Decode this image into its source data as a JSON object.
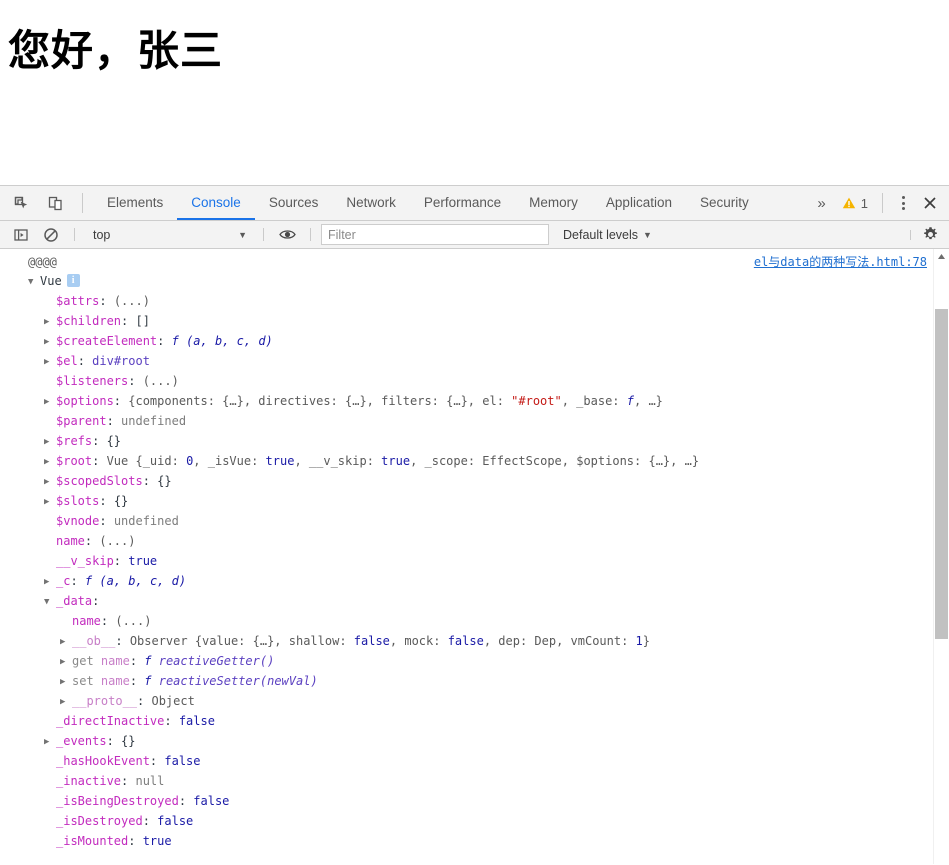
{
  "page": {
    "heading": "您好，张三"
  },
  "devtools": {
    "toolbar": {
      "inspect_icon": "inspect-element-icon",
      "device_icon": "device-toolbar-icon",
      "overflow_label": "»",
      "warning_count": "1",
      "warning_icon": "warning-triangle-icon",
      "kebab_label": "more-tools",
      "close_label": "close-devtools"
    },
    "tabs": [
      {
        "label": "Elements",
        "active": false
      },
      {
        "label": "Console",
        "active": true
      },
      {
        "label": "Sources",
        "active": false
      },
      {
        "label": "Network",
        "active": false
      },
      {
        "label": "Performance",
        "active": false
      },
      {
        "label": "Memory",
        "active": false
      },
      {
        "label": "Application",
        "active": false
      },
      {
        "label": "Security",
        "active": false
      }
    ],
    "filterbar": {
      "sidebar_icon": "console-sidebar-toggle-icon",
      "clear_icon": "clear-console-icon",
      "context_value": "top",
      "context_caret": "▼",
      "eye_icon": "live-expression-eye-icon",
      "filter_placeholder": "Filter",
      "filter_value": "",
      "levels_label": "Default levels",
      "levels_caret": "▼",
      "settings_icon": "settings-gear-icon"
    },
    "console": {
      "source_link": "el与data的两种写法.html:78",
      "at_line": "@@@@",
      "object_label": "Vue",
      "info_badge": "i",
      "lines": [
        {
          "indent": 1,
          "tri": "none",
          "key": "$attrs",
          "keycls": "prop",
          "sep": ": ",
          "value": "(...)",
          "valcls": "val-obj"
        },
        {
          "indent": 1,
          "tri": "closed",
          "key": "$children",
          "keycls": "prop",
          "sep": ": ",
          "value": "[]",
          "valcls": "punct"
        },
        {
          "indent": 1,
          "tri": "closed",
          "key": "$createElement",
          "keycls": "prop",
          "sep": ": ",
          "value": "f (a, b, c, d)",
          "valcls": "fn"
        },
        {
          "indent": 1,
          "tri": "closed",
          "key": "$el",
          "keycls": "prop",
          "sep": ": ",
          "value": "div#root",
          "valcls": "val-node"
        },
        {
          "indent": 1,
          "tri": "none",
          "key": "$listeners",
          "keycls": "prop",
          "sep": ": ",
          "value": "(...)",
          "valcls": "val-obj"
        },
        {
          "indent": 1,
          "tri": "closed",
          "key": "$options",
          "keycls": "prop",
          "sep": ": ",
          "value": "{components: {…}, directives: {…}, filters: {…}, el: \"#root\", _base: f, …}",
          "valcls": "val-obj",
          "html": "options"
        },
        {
          "indent": 1,
          "tri": "none",
          "key": "$parent",
          "keycls": "prop",
          "sep": ": ",
          "value": "undefined",
          "valcls": "val-null"
        },
        {
          "indent": 1,
          "tri": "closed",
          "key": "$refs",
          "keycls": "prop",
          "sep": ": ",
          "value": "{}",
          "valcls": "punct"
        },
        {
          "indent": 1,
          "tri": "closed",
          "key": "$root",
          "keycls": "prop",
          "sep": ": ",
          "value": "Vue {_uid: 0, _isVue: true, __v_skip: true, _scope: EffectScope, $options: {…}, …}",
          "valcls": "val-obj",
          "html": "root"
        },
        {
          "indent": 1,
          "tri": "closed",
          "key": "$scopedSlots",
          "keycls": "prop",
          "sep": ": ",
          "value": "{}",
          "valcls": "punct"
        },
        {
          "indent": 1,
          "tri": "closed",
          "key": "$slots",
          "keycls": "prop",
          "sep": ": ",
          "value": "{}",
          "valcls": "punct"
        },
        {
          "indent": 1,
          "tri": "none",
          "key": "$vnode",
          "keycls": "prop",
          "sep": ": ",
          "value": "undefined",
          "valcls": "val-null"
        },
        {
          "indent": 1,
          "tri": "none",
          "key": "name",
          "keycls": "prop",
          "sep": ": ",
          "value": "(...)",
          "valcls": "val-obj"
        },
        {
          "indent": 1,
          "tri": "none",
          "key": "__v_skip",
          "keycls": "prop",
          "sep": ": ",
          "value": "true",
          "valcls": "val-num"
        },
        {
          "indent": 1,
          "tri": "closed",
          "key": "_c",
          "keycls": "prop",
          "sep": ": ",
          "value": "f (a, b, c, d)",
          "valcls": "fn"
        },
        {
          "indent": 1,
          "tri": "open",
          "key": "_data",
          "keycls": "prop",
          "sep": ":",
          "value": "",
          "valcls": "punct"
        },
        {
          "indent": 2,
          "tri": "none",
          "key": "name",
          "keycls": "prop",
          "sep": ": ",
          "value": "(...)",
          "valcls": "val-obj"
        },
        {
          "indent": 2,
          "tri": "closed",
          "key": "__ob__",
          "keycls": "prop-dim",
          "sep": ": ",
          "value": "Observer {value: {…}, shallow: false, mock: false, dep: Dep, vmCount: 1}",
          "valcls": "val-obj",
          "html": "ob"
        },
        {
          "indent": 2,
          "tri": "closed",
          "key": "get name",
          "keycls": "prop-dim",
          "sep": ": ",
          "value": "f reactiveGetter()",
          "valcls": "fn-name",
          "html": "getter"
        },
        {
          "indent": 2,
          "tri": "closed",
          "key": "set name",
          "keycls": "prop-dim",
          "sep": ": ",
          "value": "f reactiveSetter(newVal)",
          "valcls": "fn-name",
          "html": "setter"
        },
        {
          "indent": 2,
          "tri": "closed",
          "key": "__proto__",
          "keycls": "prop-dim",
          "sep": ": ",
          "value": "Object",
          "valcls": "val-obj"
        },
        {
          "indent": 1,
          "tri": "none",
          "key": "_directInactive",
          "keycls": "prop",
          "sep": ": ",
          "value": "false",
          "valcls": "val-num"
        },
        {
          "indent": 1,
          "tri": "closed",
          "key": "_events",
          "keycls": "prop",
          "sep": ": ",
          "value": "{}",
          "valcls": "punct"
        },
        {
          "indent": 1,
          "tri": "none",
          "key": "_hasHookEvent",
          "keycls": "prop",
          "sep": ": ",
          "value": "false",
          "valcls": "val-num"
        },
        {
          "indent": 1,
          "tri": "none",
          "key": "_inactive",
          "keycls": "prop",
          "sep": ": ",
          "value": "null",
          "valcls": "val-null"
        },
        {
          "indent": 1,
          "tri": "none",
          "key": "_isBeingDestroyed",
          "keycls": "prop",
          "sep": ": ",
          "value": "false",
          "valcls": "val-num"
        },
        {
          "indent": 1,
          "tri": "none",
          "key": "_isDestroyed",
          "keycls": "prop",
          "sep": ": ",
          "value": "false",
          "valcls": "val-num"
        },
        {
          "indent": 1,
          "tri": "none",
          "key": "_isMounted",
          "keycls": "prop",
          "sep": ": ",
          "value": "true",
          "valcls": "val-num"
        }
      ]
    }
  }
}
